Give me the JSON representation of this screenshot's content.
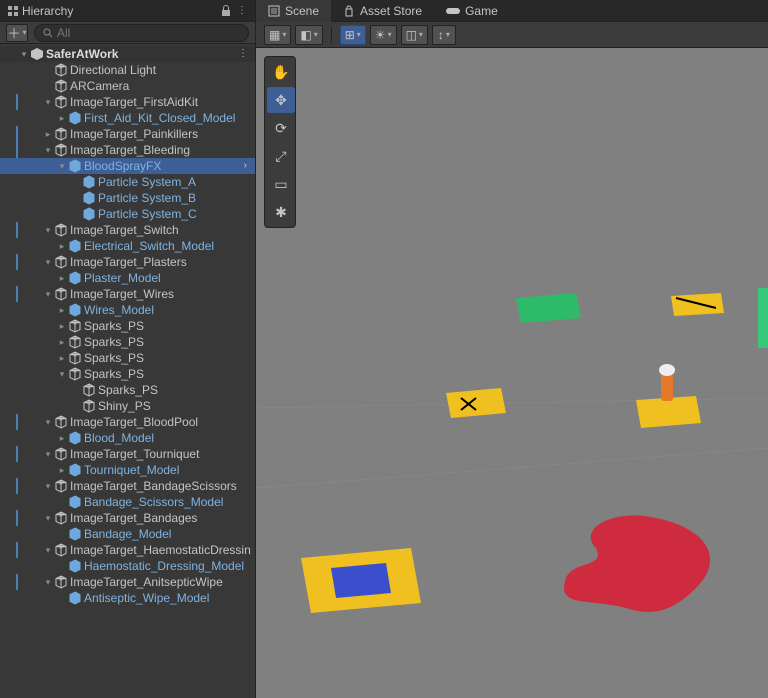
{
  "hierarchy": {
    "tab_label": "Hierarchy",
    "search_placeholder": "All",
    "scene_name": "SaferAtWork",
    "tree": [
      {
        "label": "Directional Light",
        "indent": 1,
        "prefab": false,
        "fold": "",
        "bar": false
      },
      {
        "label": "ARCamera",
        "indent": 1,
        "prefab": false,
        "fold": "",
        "bar": false
      },
      {
        "label": "ImageTarget_FirstAidKit",
        "indent": 1,
        "prefab": false,
        "fold": "down",
        "bar": true
      },
      {
        "label": "First_Aid_Kit_Closed_Model",
        "indent": 2,
        "prefab": true,
        "fold": "right",
        "bar": false
      },
      {
        "label": "ImageTarget_Painkillers",
        "indent": 1,
        "prefab": false,
        "fold": "right",
        "bar": true
      },
      {
        "label": "ImageTarget_Bleeding",
        "indent": 1,
        "prefab": false,
        "fold": "down",
        "bar": true
      },
      {
        "label": "BloodSprayFX",
        "indent": 2,
        "prefab": true,
        "fold": "down",
        "bar": false,
        "selected": true
      },
      {
        "label": "Particle System_A",
        "indent": 3,
        "prefab": true,
        "fold": "",
        "bar": false
      },
      {
        "label": "Particle System_B",
        "indent": 3,
        "prefab": true,
        "fold": "",
        "bar": false
      },
      {
        "label": "Particle System_C",
        "indent": 3,
        "prefab": true,
        "fold": "",
        "bar": false
      },
      {
        "label": "ImageTarget_Switch",
        "indent": 1,
        "prefab": false,
        "fold": "down",
        "bar": true
      },
      {
        "label": "Electrical_Switch_Model",
        "indent": 2,
        "prefab": true,
        "fold": "right",
        "bar": false
      },
      {
        "label": "ImageTarget_Plasters",
        "indent": 1,
        "prefab": false,
        "fold": "down",
        "bar": true
      },
      {
        "label": "Plaster_Model",
        "indent": 2,
        "prefab": true,
        "fold": "right",
        "bar": false
      },
      {
        "label": "ImageTarget_Wires",
        "indent": 1,
        "prefab": false,
        "fold": "down",
        "bar": true
      },
      {
        "label": "Wires_Model",
        "indent": 2,
        "prefab": true,
        "fold": "right",
        "bar": false
      },
      {
        "label": "Sparks_PS",
        "indent": 2,
        "prefab": false,
        "fold": "right",
        "bar": false
      },
      {
        "label": "Sparks_PS",
        "indent": 2,
        "prefab": false,
        "fold": "right",
        "bar": false
      },
      {
        "label": "Sparks_PS",
        "indent": 2,
        "prefab": false,
        "fold": "right",
        "bar": false
      },
      {
        "label": "Sparks_PS",
        "indent": 2,
        "prefab": false,
        "fold": "down",
        "bar": false
      },
      {
        "label": "Sparks_PS",
        "indent": 3,
        "prefab": false,
        "fold": "",
        "bar": false
      },
      {
        "label": "Shiny_PS",
        "indent": 3,
        "prefab": false,
        "fold": "",
        "bar": false
      },
      {
        "label": "ImageTarget_BloodPool",
        "indent": 1,
        "prefab": false,
        "fold": "down",
        "bar": true
      },
      {
        "label": "Blood_Model",
        "indent": 2,
        "prefab": true,
        "fold": "right",
        "bar": false
      },
      {
        "label": "ImageTarget_Tourniquet",
        "indent": 1,
        "prefab": false,
        "fold": "down",
        "bar": true
      },
      {
        "label": "Tourniquet_Model",
        "indent": 2,
        "prefab": true,
        "fold": "right",
        "bar": false
      },
      {
        "label": "ImageTarget_BandageScissors",
        "indent": 1,
        "prefab": false,
        "fold": "down",
        "bar": true
      },
      {
        "label": "Bandage_Scissors_Model",
        "indent": 2,
        "prefab": true,
        "fold": "",
        "bar": false
      },
      {
        "label": "ImageTarget_Bandages",
        "indent": 1,
        "prefab": false,
        "fold": "down",
        "bar": true
      },
      {
        "label": "Bandage_Model",
        "indent": 2,
        "prefab": true,
        "fold": "",
        "bar": false
      },
      {
        "label": "ImageTarget_HaemostaticDressin",
        "indent": 1,
        "prefab": false,
        "fold": "down",
        "bar": true
      },
      {
        "label": "Haemostatic_Dressing_Model",
        "indent": 2,
        "prefab": true,
        "fold": "",
        "bar": false
      },
      {
        "label": "ImageTarget_AnitsepticWipe",
        "indent": 1,
        "prefab": false,
        "fold": "down",
        "bar": true
      },
      {
        "label": "Antiseptic_Wipe_Model",
        "indent": 2,
        "prefab": true,
        "fold": "",
        "bar": false
      }
    ]
  },
  "main": {
    "tabs": [
      {
        "label": "Scene",
        "active": true,
        "icon": "scene-icon"
      },
      {
        "label": "Asset Store",
        "active": false,
        "icon": "bag-icon"
      },
      {
        "label": "Game",
        "active": false,
        "icon": "game-icon"
      }
    ],
    "tools": [
      {
        "name": "hand-tool",
        "glyph": "✋",
        "active": false
      },
      {
        "name": "move-tool",
        "glyph": "✥",
        "active": true
      },
      {
        "name": "rotate-tool",
        "glyph": "⟳",
        "active": false
      },
      {
        "name": "scale-tool",
        "glyph": "⤢",
        "active": false
      },
      {
        "name": "rect-tool",
        "glyph": "▭",
        "active": false
      },
      {
        "name": "transform-tool",
        "glyph": "✱",
        "active": false
      }
    ]
  }
}
